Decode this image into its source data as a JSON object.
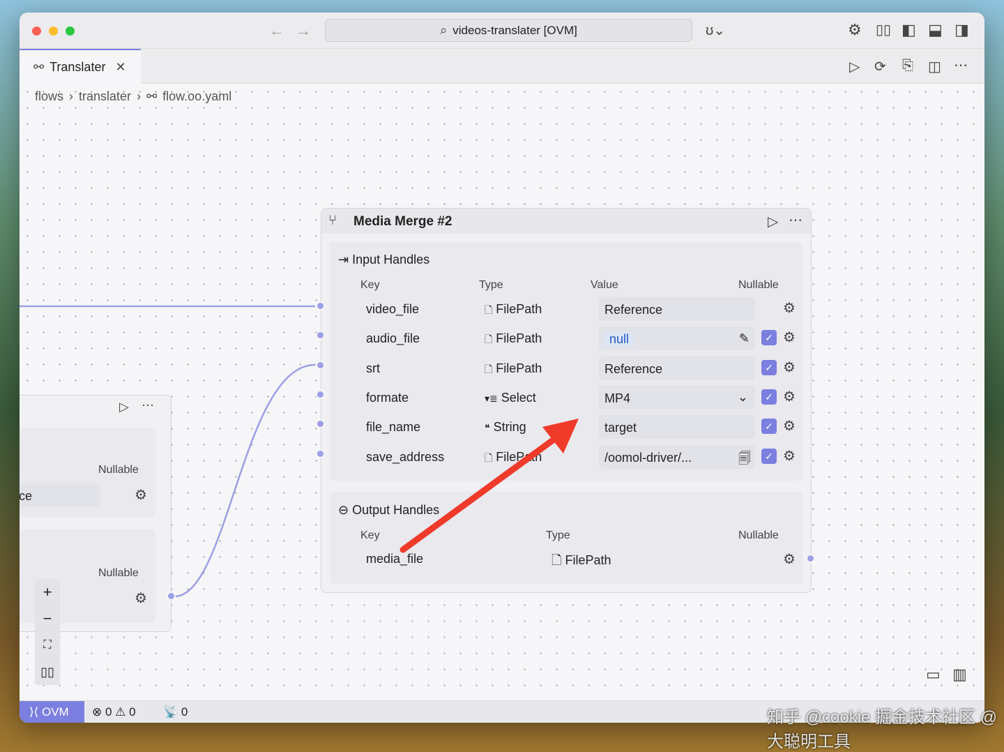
{
  "window": {
    "search_title": "videos-translater [OVM]"
  },
  "tab": {
    "label": "Translater"
  },
  "breadcrumb": [
    "flows",
    "translater",
    "flow.oo.yaml"
  ],
  "node": {
    "title": "Media Merge #2",
    "input_section": "Input Handles",
    "headers": {
      "key": "Key",
      "type": "Type",
      "value": "Value",
      "nullable": "Nullable"
    },
    "inputs": [
      {
        "key": "video_file",
        "type": "FilePath",
        "value": "Reference",
        "nullable": false
      },
      {
        "key": "audio_file",
        "type": "FilePath",
        "value": "null",
        "nullable": true
      },
      {
        "key": "srt",
        "type": "FilePath",
        "value": "Reference",
        "nullable": true
      },
      {
        "key": "formate",
        "type": "Select",
        "value": "MP4",
        "nullable": true
      },
      {
        "key": "file_name",
        "type": "String",
        "value": "target",
        "nullable": true
      },
      {
        "key": "save_address",
        "type": "FilePath",
        "value": "/oomol-driver/...",
        "nullable": true
      }
    ],
    "output_section": "Output Handles",
    "outputs": [
      {
        "key": "media_file",
        "type": "FilePath"
      }
    ]
  },
  "left_node": {
    "nullable1": "Nullable",
    "value_fragment": "ce",
    "nullable2": "Nullable"
  },
  "status": {
    "env": "OVM",
    "errors": "0",
    "warnings": "0",
    "ports": "0"
  },
  "watermark": "知乎 @cookie 掘金技术社区 @大聪明工具",
  "colors": {
    "accent": "#7b7fe0",
    "arrow": "#f03a2a"
  }
}
